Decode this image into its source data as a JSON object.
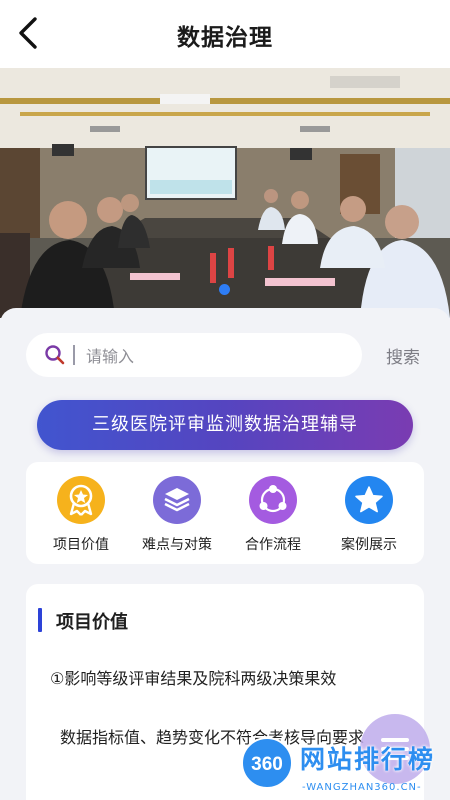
{
  "header": {
    "title": "数据治理"
  },
  "banner": {
    "image": "conference-meeting-photo",
    "active_slide": 1,
    "slides_shown": 1
  },
  "search": {
    "placeholder": "请输入",
    "button_label": "搜索"
  },
  "cta": {
    "label": "三级医院评审监测数据治理辅导"
  },
  "quick_links": [
    {
      "label": "项目价值",
      "icon": "award-medal-icon",
      "color": "#f6b21c"
    },
    {
      "label": "难点与对策",
      "icon": "layers-icon",
      "color": "#7c6bd8"
    },
    {
      "label": "合作流程",
      "icon": "share-nodes-icon",
      "color": "#a45be0"
    },
    {
      "label": "案例展示",
      "icon": "star-icon",
      "color": "#2386f0"
    }
  ],
  "section": {
    "title": "项目价值",
    "paragraphs": [
      "①影响等级评审结果及院科两级决策果效",
      "数据指标值、趋势变化不符合考核导向要求"
    ]
  },
  "watermark": {
    "brand": "网站排行榜",
    "sub": "-WANGZHAN360.CN-",
    "logo_text": "360"
  },
  "colors": {
    "accent": "#2d43d8",
    "cta_start": "#4155cf",
    "cta_end": "#7a3cb2",
    "background": "#f2f3f7"
  }
}
